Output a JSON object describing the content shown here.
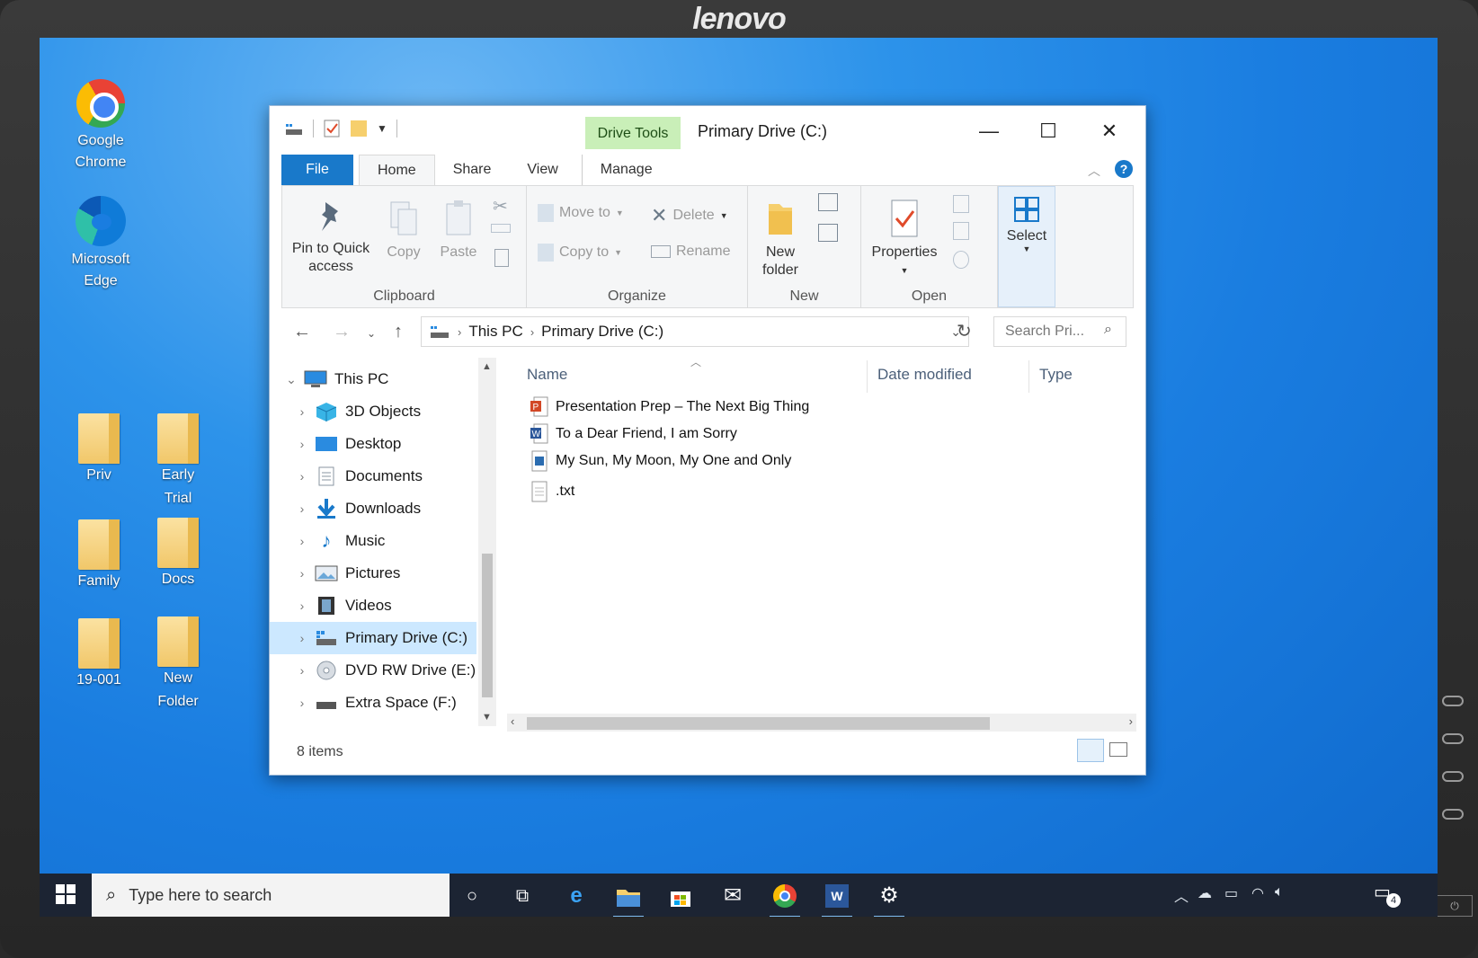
{
  "monitor": {
    "brand": "lenovo"
  },
  "desktop": {
    "icons": [
      {
        "label": "Google\nChrome",
        "label_line1": "Google",
        "label_line2": "Chrome"
      },
      {
        "label_line1": "Microsoft",
        "label_line2": "Edge"
      },
      {
        "label_line1": "Priv",
        "label_line2": ""
      },
      {
        "label_line1": "Early",
        "label_line2": "Trial"
      },
      {
        "label_line1": "Family",
        "label_line2": ""
      },
      {
        "label_line1": "Docs",
        "label_line2": ""
      },
      {
        "label_line1": "19-001",
        "label_line2": ""
      },
      {
        "label_line1": "New",
        "label_line2": "Folder"
      }
    ]
  },
  "explorer": {
    "context_tab": "Drive Tools",
    "title": "Primary Drive (C:)",
    "controls": {
      "minimize": "—",
      "maximize": "☐",
      "close": "✕"
    },
    "tabs": {
      "file": "File",
      "home": "Home",
      "share": "Share",
      "view": "View",
      "manage": "Manage"
    },
    "ribbon": {
      "clipboard": {
        "label": "Clipboard",
        "pin_line1": "Pin to Quick",
        "pin_line2": "access",
        "copy": "Copy",
        "paste": "Paste"
      },
      "organize": {
        "label": "Organize",
        "move_to": "Move to",
        "copy_to": "Copy to",
        "delete": "Delete",
        "rename": "Rename"
      },
      "new": {
        "label": "New",
        "new_folder_line1": "New",
        "new_folder_line2": "folder"
      },
      "open": {
        "label": "Open",
        "properties": "Properties"
      },
      "select": {
        "label": "Select"
      }
    },
    "address": {
      "crumbs": [
        "This PC",
        "Primary Drive (C:)"
      ]
    },
    "search": {
      "placeholder": "Search Pri..."
    },
    "nav": {
      "items": [
        {
          "label": "This PC",
          "icon": "computer-icon"
        },
        {
          "label": "3D Objects",
          "icon": "cube-icon"
        },
        {
          "label": "Desktop",
          "icon": "desktop-icon"
        },
        {
          "label": "Documents",
          "icon": "documents-icon"
        },
        {
          "label": "Downloads",
          "icon": "download-icon"
        },
        {
          "label": "Music",
          "icon": "music-icon"
        },
        {
          "label": "Pictures",
          "icon": "pictures-icon"
        },
        {
          "label": "Videos",
          "icon": "videos-icon"
        },
        {
          "label": "Primary Drive (C:)",
          "icon": "drive-icon",
          "selected": true
        },
        {
          "label": "DVD RW Drive (E:)",
          "icon": "dvd-icon"
        },
        {
          "label": "Extra Space (F:)",
          "icon": "drive-icon"
        }
      ]
    },
    "columns": {
      "name": "Name",
      "date_modified": "Date modified",
      "type": "Type"
    },
    "files": [
      {
        "name": "Presentation Prep – The Next Big Thing",
        "icon": "powerpoint-icon"
      },
      {
        "name": "To a Dear Friend, I am Sorry",
        "icon": "word-icon"
      },
      {
        "name": "My Sun, My Moon, My One and Only",
        "icon": "image-icon"
      },
      {
        "name": ".txt",
        "icon": "text-file-icon"
      }
    ],
    "status": "8 items"
  },
  "taskbar": {
    "search_placeholder": "Type here to search",
    "notification_count": "4"
  },
  "colors": {
    "accent": "#1979ca",
    "drive_tools": "#c9efb8",
    "desktop": "#1a7de0",
    "taskbar": "#1c2433"
  }
}
